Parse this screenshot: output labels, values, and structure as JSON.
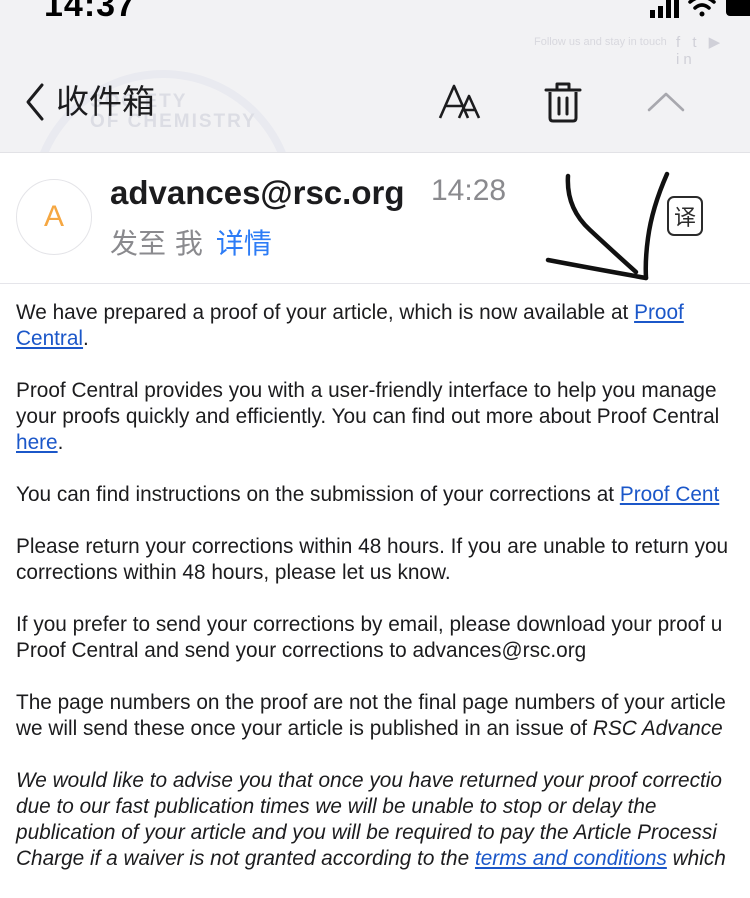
{
  "status_bar": {
    "time": "14:37"
  },
  "watermark": {
    "banner": "Follow us and stay in touch",
    "social": "f  t  ▶  in",
    "org_text_1": "SOCIETY",
    "org_text_2": "OF CHEMISTRY"
  },
  "toolbar": {
    "back_label": "收件箱"
  },
  "email": {
    "avatar_letter": "A",
    "sender": "advances@rsc.org",
    "time": "14:28",
    "recipients_prefix": "发至 我",
    "details_link": "详情",
    "translate_label": "译"
  },
  "body": {
    "p1_text": "We have prepared a proof of your article, which is now available at ",
    "p1_link_a": "Proof",
    "p1_link_b": "Central",
    "p1_end": ".",
    "p2_line1": "Proof Central provides you with a user-friendly interface to help you manage",
    "p2_line2": "your proofs quickly and efficiently. You can find out more about Proof Central",
    "p2_link": "here",
    "p2_end": ".",
    "p3_text": "You can find instructions on the submission of your corrections at ",
    "p3_link": "Proof Cent",
    "p4_line1": "Please return your corrections within 48 hours. If you are unable to return you",
    "p4_line2": "corrections within 48 hours, please let us know.",
    "p5_line1": "If you prefer to send your corrections by email, please download your proof u",
    "p5_line2": "Proof Central and send your corrections to advances@rsc.org",
    "p6_line1": "The page numbers on the proof are not the final page numbers of your article",
    "p6_line2": "we will send these once your article is published in an issue of ",
    "p6_italic": "RSC Advance",
    "p7_line1": "We would like to advise you that once you have returned your proof correctio",
    "p7_line2": "due to our fast publication times we will be unable to stop or delay the",
    "p7_line3": "publication of your article and you will be required to pay the Article Processi",
    "p7_line4_a": "Charge if a waiver is not granted according to the ",
    "p7_line4_link": "terms and conditions",
    "p7_line4_b": " which"
  }
}
